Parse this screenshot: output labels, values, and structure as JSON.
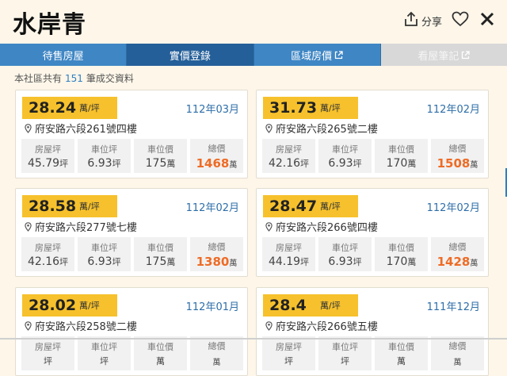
{
  "header": {
    "title": "水岸青",
    "share_label": "分享"
  },
  "tabs": [
    {
      "label": "待售房屋"
    },
    {
      "label": "實價登錄"
    },
    {
      "label": "區域房價"
    },
    {
      "label": "看屋筆記"
    }
  ],
  "summary": {
    "prefix": "本社區共有",
    "count": "151",
    "suffix": "筆成交資料"
  },
  "labels": {
    "unit_price": "萬/坪",
    "house_ping": "房屋坪",
    "parking_ping": "車位坪",
    "parking_price": "車位價",
    "total_price": "總價",
    "ping_unit": "坪",
    "wan_unit": "萬"
  },
  "transactions": [
    {
      "price": "28.24",
      "date": "112年03月",
      "address": "府安路六段261號四樓",
      "house_ping": "45.79",
      "parking_ping": "6.93",
      "parking_price": "175",
      "total": "1468"
    },
    {
      "price": "31.73",
      "date": "112年02月",
      "address": "府安路六段265號二樓",
      "house_ping": "42.16",
      "parking_ping": "6.93",
      "parking_price": "170",
      "total": "1508"
    },
    {
      "price": "28.58",
      "date": "112年02月",
      "address": "府安路六段277號七樓",
      "house_ping": "42.16",
      "parking_ping": "6.93",
      "parking_price": "175",
      "total": "1380"
    },
    {
      "price": "28.47",
      "date": "112年02月",
      "address": "府安路六段266號四樓",
      "house_ping": "44.19",
      "parking_ping": "6.93",
      "parking_price": "170",
      "total": "1428"
    },
    {
      "price": "28.02",
      "date": "112年01月",
      "address": "府安路六段258號二樓",
      "house_ping": "",
      "parking_ping": "",
      "parking_price": "",
      "total": ""
    },
    {
      "price": "28.4",
      "date": "111年12月",
      "address": "府安路六段266號五樓",
      "house_ping": "",
      "parking_ping": "",
      "parking_price": "",
      "total": ""
    }
  ],
  "colors": {
    "tab_blue": "#3f86c4",
    "tab_active": "#245f99",
    "badge_yellow": "#f6c12c",
    "total_orange": "#ee6b25",
    "date_blue": "#2e6ea8",
    "background": "#fdf6e9"
  }
}
